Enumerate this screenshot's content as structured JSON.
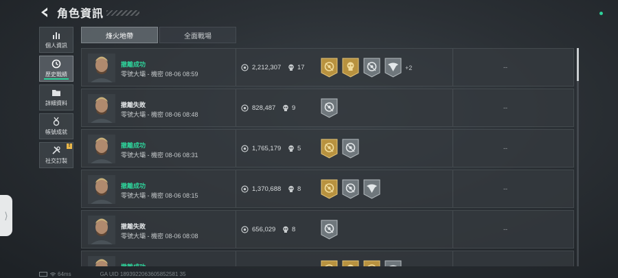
{
  "header": {
    "title": "角色資訊",
    "back_icon": "back-arrow-icon"
  },
  "colors": {
    "accent_green": "#2ed29a",
    "badge_gold": "#c9a24e",
    "badge_gray": "#8e969b"
  },
  "sidebar": {
    "items": [
      {
        "label": "個人資訊",
        "icon": "bar-chart-icon"
      },
      {
        "label": "歷史戰績",
        "icon": "clock-icon",
        "active": true
      },
      {
        "label": "詳細資料",
        "icon": "folder-icon"
      },
      {
        "label": "帳號成就",
        "icon": "medal-icon"
      },
      {
        "label": "社交訂製",
        "icon": "tools-icon",
        "badge": "!"
      }
    ]
  },
  "tabs": [
    {
      "label": "烽火地帶",
      "active": true
    },
    {
      "label": "全面戰場",
      "active": false
    }
  ],
  "records": [
    {
      "result": "撤離成功",
      "status": "success",
      "map": "零號大壩 - 機密 08-06 08:59",
      "money": "2,212,307",
      "kills": "17",
      "badges": [
        "gold-crosshair",
        "gold-skull",
        "gray-crosshair",
        "gray-eagle"
      ],
      "extra": "+2",
      "rating": "--"
    },
    {
      "result": "撤離失敗",
      "status": "fail",
      "map": "零號大壩 - 機密 08-06 08:48",
      "money": "828,487",
      "kills": "9",
      "badges": [
        "gray-crosshair"
      ],
      "extra": "",
      "rating": "--"
    },
    {
      "result": "撤離成功",
      "status": "success",
      "map": "零號大壩 - 機密 08-06 08:31",
      "money": "1,765,179",
      "kills": "5",
      "badges": [
        "gold-crosshair",
        "gray-crosshair"
      ],
      "extra": "",
      "rating": "--"
    },
    {
      "result": "撤離成功",
      "status": "success",
      "map": "零號大壩 - 機密 08-06 08:15",
      "money": "1,370,688",
      "kills": "8",
      "badges": [
        "gold-crosshair",
        "gray-crosshair",
        "gray-eagle"
      ],
      "extra": "",
      "rating": "--"
    },
    {
      "result": "撤離失敗",
      "status": "fail",
      "map": "零號大壩 - 機密 08-06 08:08",
      "money": "656,029",
      "kills": "8",
      "badges": [
        "gray-crosshair"
      ],
      "extra": "",
      "rating": "--"
    },
    {
      "result": "撤離成功",
      "status": "success",
      "map": "",
      "money": "",
      "kills": "",
      "badges": [
        "gold-crosshair",
        "gold-skull",
        "gold-crosshair",
        "gray-eagle"
      ],
      "extra": "",
      "rating": ""
    }
  ],
  "footer": {
    "ping": "64ms",
    "uid": "GA UID 1893922063605852581 35"
  }
}
